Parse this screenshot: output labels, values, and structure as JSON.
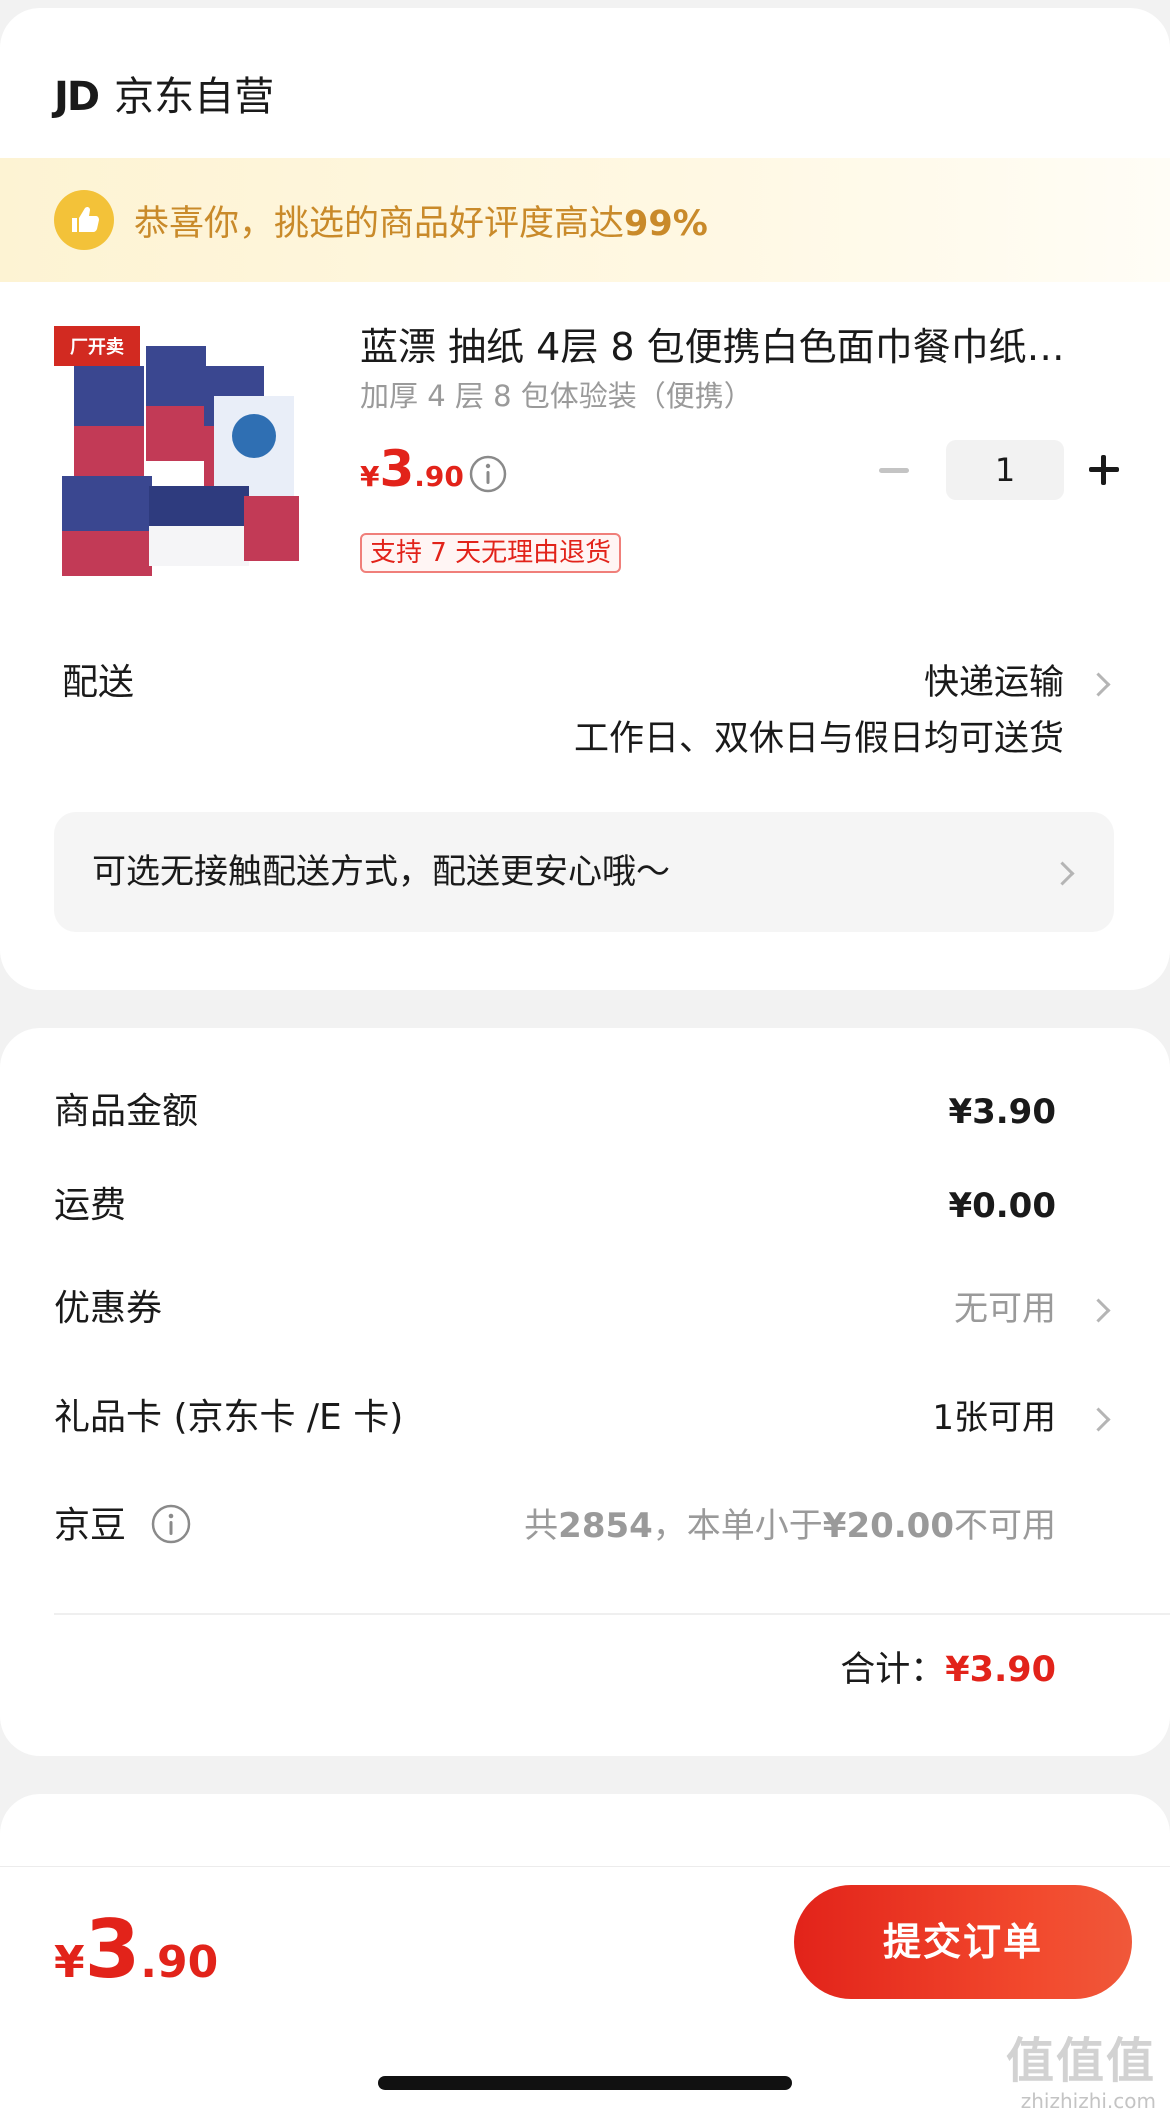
{
  "shop": {
    "logo": "JD",
    "name": "京东自营"
  },
  "banner": {
    "text": "恭喜你，挑选的商品好评度高达",
    "percent": "99%"
  },
  "product": {
    "image_badge": "厂开卖",
    "title": "蓝漂 抽纸 4层 8 包便携白色面巾餐巾纸…",
    "spec": "加厚 4 层 8 包体验装（便携）",
    "price_yen": "¥",
    "price_int": "3",
    "price_dec": ".90",
    "return_badge": "支持 7 天无理由退货",
    "quantity": "1"
  },
  "delivery": {
    "label": "配送",
    "method": "快递运输",
    "time": "工作日、双休日与假日均可送货",
    "contactless": "可选无接触配送方式，配送更安心哦～"
  },
  "price_detail": {
    "goods_label": "商品金额",
    "goods_value": "¥3.90",
    "shipping_label": "运费",
    "shipping_value": "¥0.00",
    "coupon_label": "优惠券",
    "coupon_value": "无可用",
    "giftcard_label": "礼品卡 (京东卡 /E 卡)",
    "giftcard_value": "1张可用",
    "beans_label": "京豆",
    "beans_value_prefix": "共",
    "beans_count": "2854",
    "beans_value_mid": "，本单小于",
    "beans_threshold": "¥20.00",
    "beans_value_suffix": "不可用",
    "total_label": "合计：",
    "total_value": "¥3.90"
  },
  "bottom": {
    "price_yen": "¥",
    "price_int": "3",
    "price_dec": ".90",
    "submit_label": "提交订单"
  },
  "watermark": {
    "logo": "值值值",
    "domain": "zhizhizhi.com"
  },
  "colors": {
    "accent": "#e2231a",
    "banner_text": "#c98a2a",
    "thumb_icon": "#f3c239"
  }
}
